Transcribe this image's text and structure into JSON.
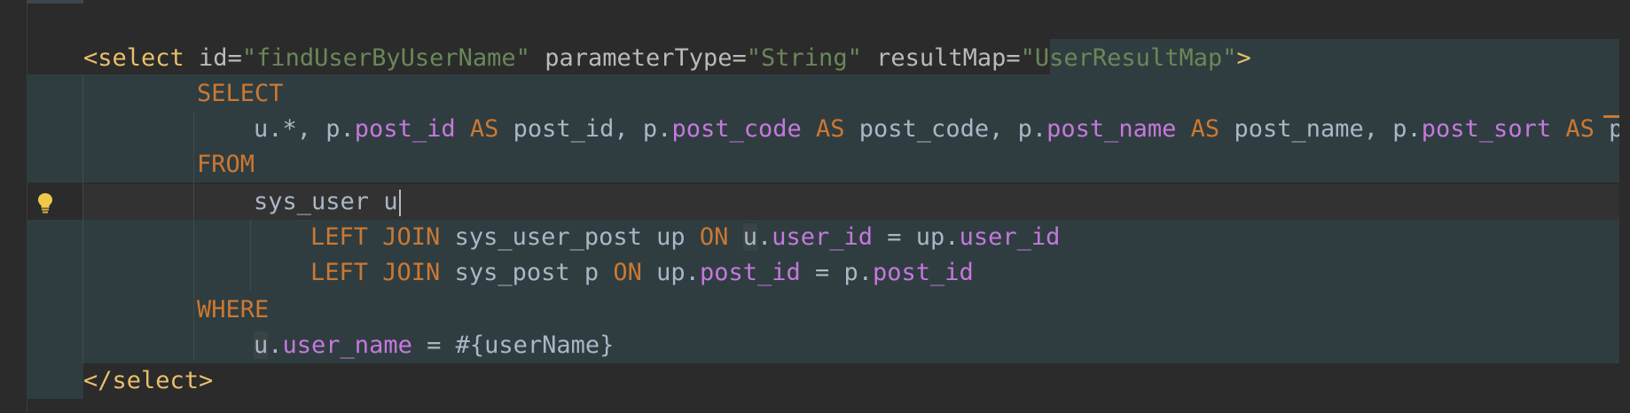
{
  "editor": {
    "lines": {
      "l1": {
        "open_tag": "<select",
        "attr_id": " id=",
        "val_id": "\"findUserByUserName\"",
        "attr_param": " parameterType=",
        "val_param": "\"String\"",
        "attr_result": " resultMap=",
        "val_result": "\"UserResultMap\"",
        "close": ">"
      },
      "l2": {
        "kw": "SELECT"
      },
      "l3": {
        "t1": "u.*, p.",
        "f1": "post_id",
        "k1": " AS ",
        "t2": "post_id, p.",
        "f2": "post_code",
        "k2": " AS ",
        "t3": "post_code, p.",
        "f3": "post_name",
        "k3": " AS ",
        "t4": "post_name, p.",
        "f4": "post_sort",
        "k4": " AS ",
        "t5": "pos"
      },
      "l4": {
        "kw": "FROM"
      },
      "l5": {
        "t1": "sys_user ",
        "t2": "u"
      },
      "l6": {
        "k1": "LEFT JOIN ",
        "t1": "sys_user_post up ",
        "k2": "ON ",
        "t2": "u",
        "t3": ".",
        "f1": "user_id",
        "t4": " = up.",
        "f2": "user_id"
      },
      "l7": {
        "k1": "LEFT JOIN ",
        "t1": "sys_post p ",
        "k2": "ON ",
        "t2": "up.",
        "f1": "post_id",
        "t3": " = p.",
        "f2": "post_id"
      },
      "l8": {
        "kw": "WHERE"
      },
      "l9": {
        "t1": "u",
        "t2": ".",
        "f1": "user_name",
        "t3": " = #{userName}"
      },
      "l10": {
        "tag": "</select>"
      }
    },
    "icons": {
      "intention": "lightbulb-icon"
    },
    "colors": {
      "background": "#2b2b2b",
      "injected_background": "#2f3d40",
      "tag": "#e8bf6a",
      "string": "#6a8759",
      "keyword": "#cc7832",
      "field": "#c678dd",
      "text": "#a9b7c6"
    }
  }
}
